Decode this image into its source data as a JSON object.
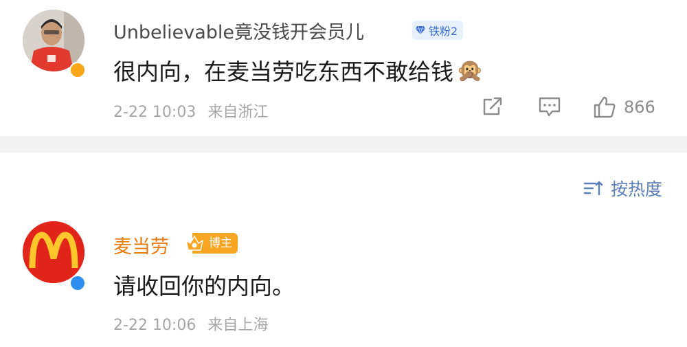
{
  "comments": [
    {
      "username": "Unbelievable竟没钱开会员儿",
      "fan_badge": "铁粉2",
      "text": "很内向，在麦当劳吃东西不敢给钱",
      "emoji": "🙊",
      "date": "2-22 10:03",
      "location": "来自浙江",
      "likes": "866",
      "verify_color": "#f7a718"
    },
    {
      "username": "麦当劳",
      "badge": "博主",
      "text": "请收回你的内向。",
      "date": "2-22 10:06",
      "location": "来自上海",
      "verify_color": "#2f8ff0"
    }
  ],
  "sort_label": "按热度",
  "icons": {
    "share": "share-icon",
    "comment": "comment-icon",
    "like": "thumbs-up-icon",
    "sort": "sort-icon",
    "diamond": "diamond-icon",
    "crown": "crown-icon"
  },
  "colors": {
    "brand_name": "#ea7b0e",
    "blogger_badge": "#f6a623",
    "fan_badge_bg": "#e8f0fb",
    "mcdonalds_red": "#e1251b",
    "mcdonalds_yellow": "#ffc72c"
  }
}
